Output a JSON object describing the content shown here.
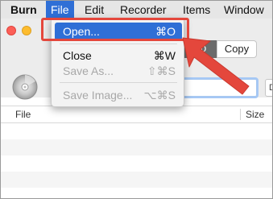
{
  "menubar": {
    "app_name": "Burn",
    "items": [
      {
        "label": "File"
      },
      {
        "label": "Edit"
      },
      {
        "label": "Recorder"
      },
      {
        "label": "Items"
      },
      {
        "label": "Window"
      }
    ]
  },
  "window": {
    "segmented": {
      "video_label": "ideo",
      "copy_label": "Copy"
    },
    "side_button_label": "D",
    "list": {
      "columns": [
        "File",
        "Size"
      ]
    }
  },
  "file_menu": {
    "items": [
      {
        "label": "Open...",
        "shortcut": "⌘O",
        "state": "highlighted"
      },
      {
        "label": "Close",
        "shortcut": "⌘W",
        "state": "enabled"
      },
      {
        "label": "Save As...",
        "shortcut": "⇧⌘S",
        "state": "disabled"
      },
      {
        "label": "Save Image...",
        "shortcut": "⌥⌘S",
        "state": "disabled"
      }
    ]
  },
  "annotation": {
    "color": "#e4473c"
  },
  "colors": {
    "accent": "#2f6fd6",
    "menubar_bg": "#e6e6e6"
  }
}
